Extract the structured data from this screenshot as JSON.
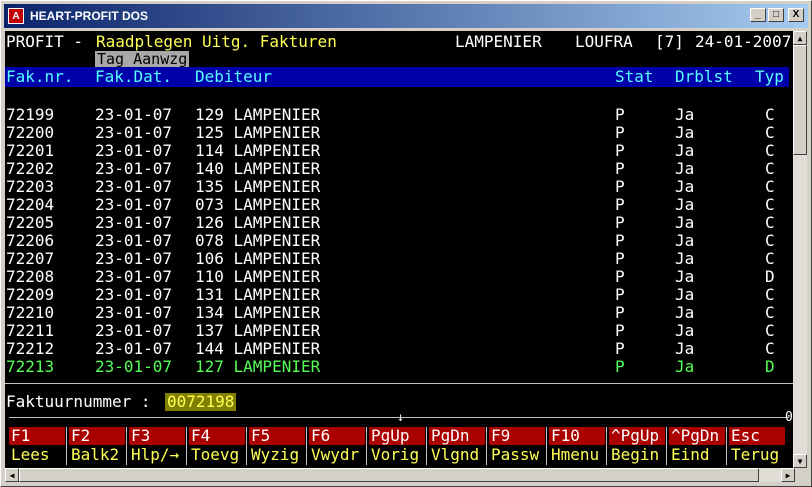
{
  "window": {
    "title": "HEART-PROFIT DOS",
    "icon": "app-icon",
    "buttons": [
      "_",
      "□",
      "X"
    ]
  },
  "header": {
    "app": "PROFIT -",
    "screen": "Raadplegen Uitg. Fakturen",
    "company": "LAMPENIER",
    "user": "LOUFRA",
    "session": "[7]",
    "date": "24-01-2007",
    "tag": "Tag Aanwzg"
  },
  "columns": {
    "fak_nr": "Fak.nr.",
    "fak_dat": "Fak.Dat.",
    "debiteur": "Debiteur",
    "stat": "Stat",
    "drblst": "Drblst",
    "typ": "Typ"
  },
  "rows": [
    {
      "nr": "72199",
      "dat": "23-01-07",
      "deb": "129 LAMPENIER",
      "stat": "P",
      "drblst": "Ja",
      "typ": "C"
    },
    {
      "nr": "72200",
      "dat": "23-01-07",
      "deb": "125 LAMPENIER",
      "stat": "P",
      "drblst": "Ja",
      "typ": "C"
    },
    {
      "nr": "72201",
      "dat": "23-01-07",
      "deb": "114 LAMPENIER",
      "stat": "P",
      "drblst": "Ja",
      "typ": "C"
    },
    {
      "nr": "72202",
      "dat": "23-01-07",
      "deb": "140 LAMPENIER",
      "stat": "P",
      "drblst": "Ja",
      "typ": "C"
    },
    {
      "nr": "72203",
      "dat": "23-01-07",
      "deb": "135 LAMPENIER",
      "stat": "P",
      "drblst": "Ja",
      "typ": "C"
    },
    {
      "nr": "72204",
      "dat": "23-01-07",
      "deb": "073 LAMPENIER",
      "stat": "P",
      "drblst": "Ja",
      "typ": "C"
    },
    {
      "nr": "72205",
      "dat": "23-01-07",
      "deb": "126 LAMPENIER",
      "stat": "P",
      "drblst": "Ja",
      "typ": "C"
    },
    {
      "nr": "72206",
      "dat": "23-01-07",
      "deb": "078 LAMPENIER",
      "stat": "P",
      "drblst": "Ja",
      "typ": "C"
    },
    {
      "nr": "72207",
      "dat": "23-01-07",
      "deb": "106 LAMPENIER",
      "stat": "P",
      "drblst": "Ja",
      "typ": "C"
    },
    {
      "nr": "72208",
      "dat": "23-01-07",
      "deb": "110 LAMPENIER",
      "stat": "P",
      "drblst": "Ja",
      "typ": "D"
    },
    {
      "nr": "72209",
      "dat": "23-01-07",
      "deb": "131 LAMPENIER",
      "stat": "P",
      "drblst": "Ja",
      "typ": "C"
    },
    {
      "nr": "72210",
      "dat": "23-01-07",
      "deb": "134 LAMPENIER",
      "stat": "P",
      "drblst": "Ja",
      "typ": "C"
    },
    {
      "nr": "72211",
      "dat": "23-01-07",
      "deb": "137 LAMPENIER",
      "stat": "P",
      "drblst": "Ja",
      "typ": "C"
    },
    {
      "nr": "72212",
      "dat": "23-01-07",
      "deb": "144 LAMPENIER",
      "stat": "P",
      "drblst": "Ja",
      "typ": "C"
    },
    {
      "nr": "72213",
      "dat": "23-01-07",
      "deb": "127 LAMPENIER",
      "stat": "P",
      "drblst": "Ja",
      "typ": "D"
    }
  ],
  "selected_row": "72213",
  "prompt": {
    "label": "Faktuurnummer :",
    "value": "0072198"
  },
  "ruler": {
    "marker": "↓",
    "end": "0"
  },
  "fkeys": [
    {
      "key": "F1",
      "label": "Lees"
    },
    {
      "key": "F2",
      "label": "Balk2"
    },
    {
      "key": "F3",
      "label": "Hlp/→"
    },
    {
      "key": "F4",
      "label": "Toevg"
    },
    {
      "key": "F5",
      "label": "Wyzig"
    },
    {
      "key": "F6",
      "label": "Vwydr"
    },
    {
      "key": "PgUp",
      "label": "Vorig"
    },
    {
      "key": "PgDn",
      "label": "Vlgnd"
    },
    {
      "key": "F9",
      "label": "Passw"
    },
    {
      "key": "F10",
      "label": "Hmenu"
    },
    {
      "key": "^PgUp",
      "label": "Begin"
    },
    {
      "key": "^PgDn",
      "label": "Eind"
    },
    {
      "key": "Esc",
      "label": "Terug"
    }
  ],
  "colors": {
    "console_bg": "#000000",
    "header_bar": "#0000aa",
    "selected_text": "#55ff55",
    "highlight_text": "#ffff55",
    "fkey_bg": "#aa0000"
  }
}
